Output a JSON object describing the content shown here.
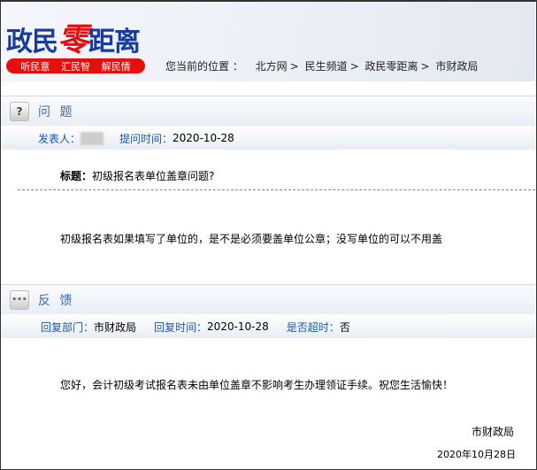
{
  "logo": {
    "part1": "政民",
    "part2": "零",
    "part3": "距离",
    "tags": [
      "听民意",
      "汇民智",
      "解民情"
    ]
  },
  "breadcrumb": {
    "label": "您当前的位置 ：",
    "items": [
      "北方网",
      "民生频道",
      "政民零距离",
      "市财政局"
    ],
    "sep": ">"
  },
  "question": {
    "section_title": "问 题",
    "poster_label": "发表人：",
    "time_label": "提问时间：",
    "time": "2020-10-28",
    "title_label": "标题：",
    "title": "初级报名表单位盖章问题?",
    "content": "初级报名表如果填写了单位的，是不是必须要盖单位公章；没写单位的可以不用盖"
  },
  "feedback": {
    "section_title": "反 馈",
    "dept_label": "回复部门：",
    "dept": "市财政局",
    "time_label": "回复时间：",
    "time": "2020-10-28",
    "overdue_label": "是否超时：",
    "overdue": "否",
    "content": "您好，会计初级考试报名表未由单位盖章不影响考生办理领证手续。祝您生活愉快！",
    "signature": "市财政局",
    "date": "2020年10月28日"
  }
}
